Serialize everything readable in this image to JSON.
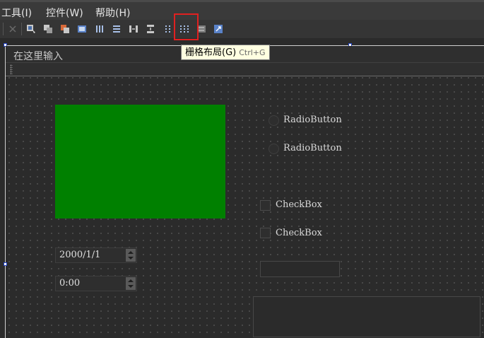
{
  "menubar": {
    "items": [
      {
        "label": "工具(I)",
        "name": "menu-tools"
      },
      {
        "label": "控件(W)",
        "name": "menu-widgets"
      },
      {
        "label": "帮助(H)",
        "name": "menu-help"
      }
    ]
  },
  "toolbar": {
    "icons": [
      "close-icon",
      "edit-widgets-icon",
      "edit-signals-slots-icon",
      "edit-buddies-icon",
      "edit-tab-order-icon",
      "layout-horizontal-icon",
      "layout-vertical-icon",
      "layout-horizontal-splitter-icon",
      "layout-vertical-splitter-icon",
      "layout-form-icon",
      "layout-grid-icon",
      "break-layout-icon",
      "adjust-size-icon"
    ],
    "highlighted": "layout-grid-icon",
    "highlight_color": "#e02020"
  },
  "tooltip": {
    "text": "栅格布局(G)",
    "shortcut": "Ctrl+G"
  },
  "form": {
    "menu_placeholder": "在这里输入",
    "green_widget_color": "#008000",
    "radio_buttons": [
      "RadioButton",
      "RadioButton"
    ],
    "checkboxes": [
      "CheckBox",
      "CheckBox"
    ],
    "date_edit": "2000/1/1",
    "time_edit": "0:00"
  }
}
